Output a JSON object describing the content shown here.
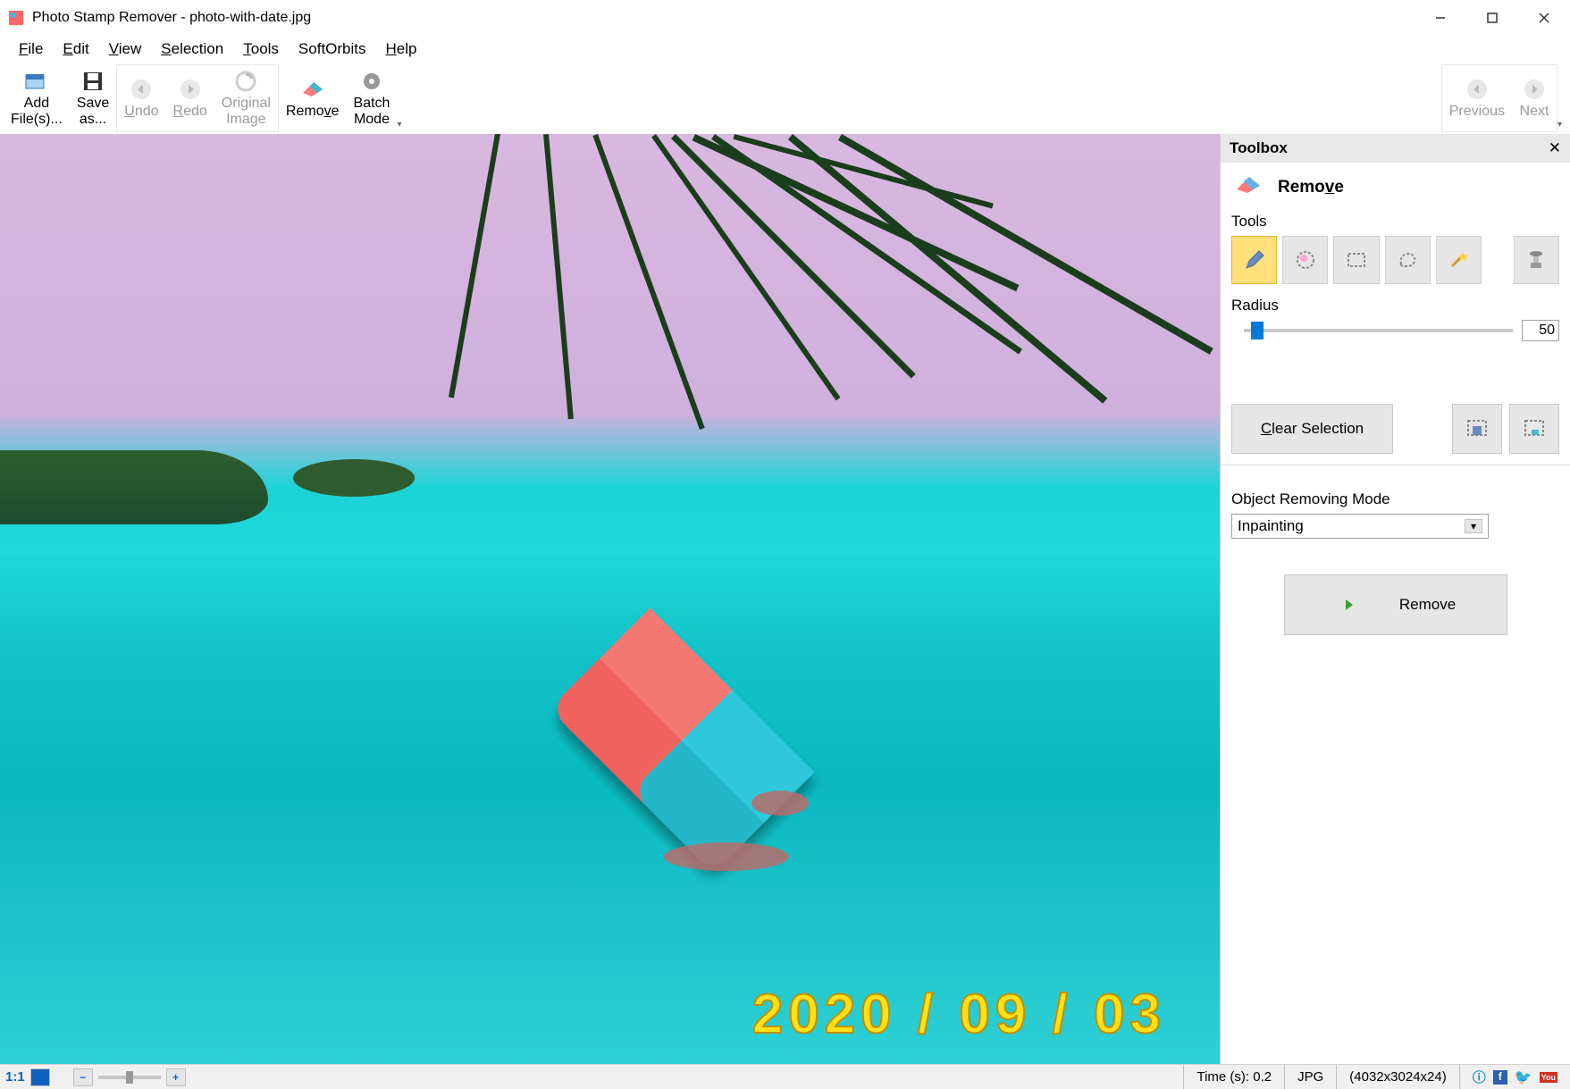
{
  "titlebar": {
    "title": "Photo Stamp Remover - photo-with-date.jpg"
  },
  "menu": {
    "file": "File",
    "edit": "Edit",
    "view": "View",
    "selection": "Selection",
    "tools": "Tools",
    "softorbits": "SoftOrbits",
    "help": "Help"
  },
  "toolbar": {
    "add_files": "Add\nFile(s)...",
    "save_as": "Save\nas...",
    "undo": "Undo",
    "redo": "Redo",
    "original_image": "Original\nImage",
    "remove": "Remove",
    "batch_mode": "Batch\nMode",
    "previous": "Previous",
    "next": "Next"
  },
  "sidebar": {
    "toolbox_title": "Toolbox",
    "remove_header": "Remove",
    "tools_label": "Tools",
    "radius_label": "Radius",
    "radius_value": "50",
    "clear_selection": "Clear Selection",
    "mode_label": "Object Removing Mode",
    "mode_value": "Inpainting",
    "remove_button": "Remove"
  },
  "canvas": {
    "date_stamp": "2020 / 09 / 03"
  },
  "statusbar": {
    "ratio": "1:1",
    "time": "Time (s): 0.2",
    "format": "JPG",
    "dimensions": "(4032x3024x24)"
  }
}
